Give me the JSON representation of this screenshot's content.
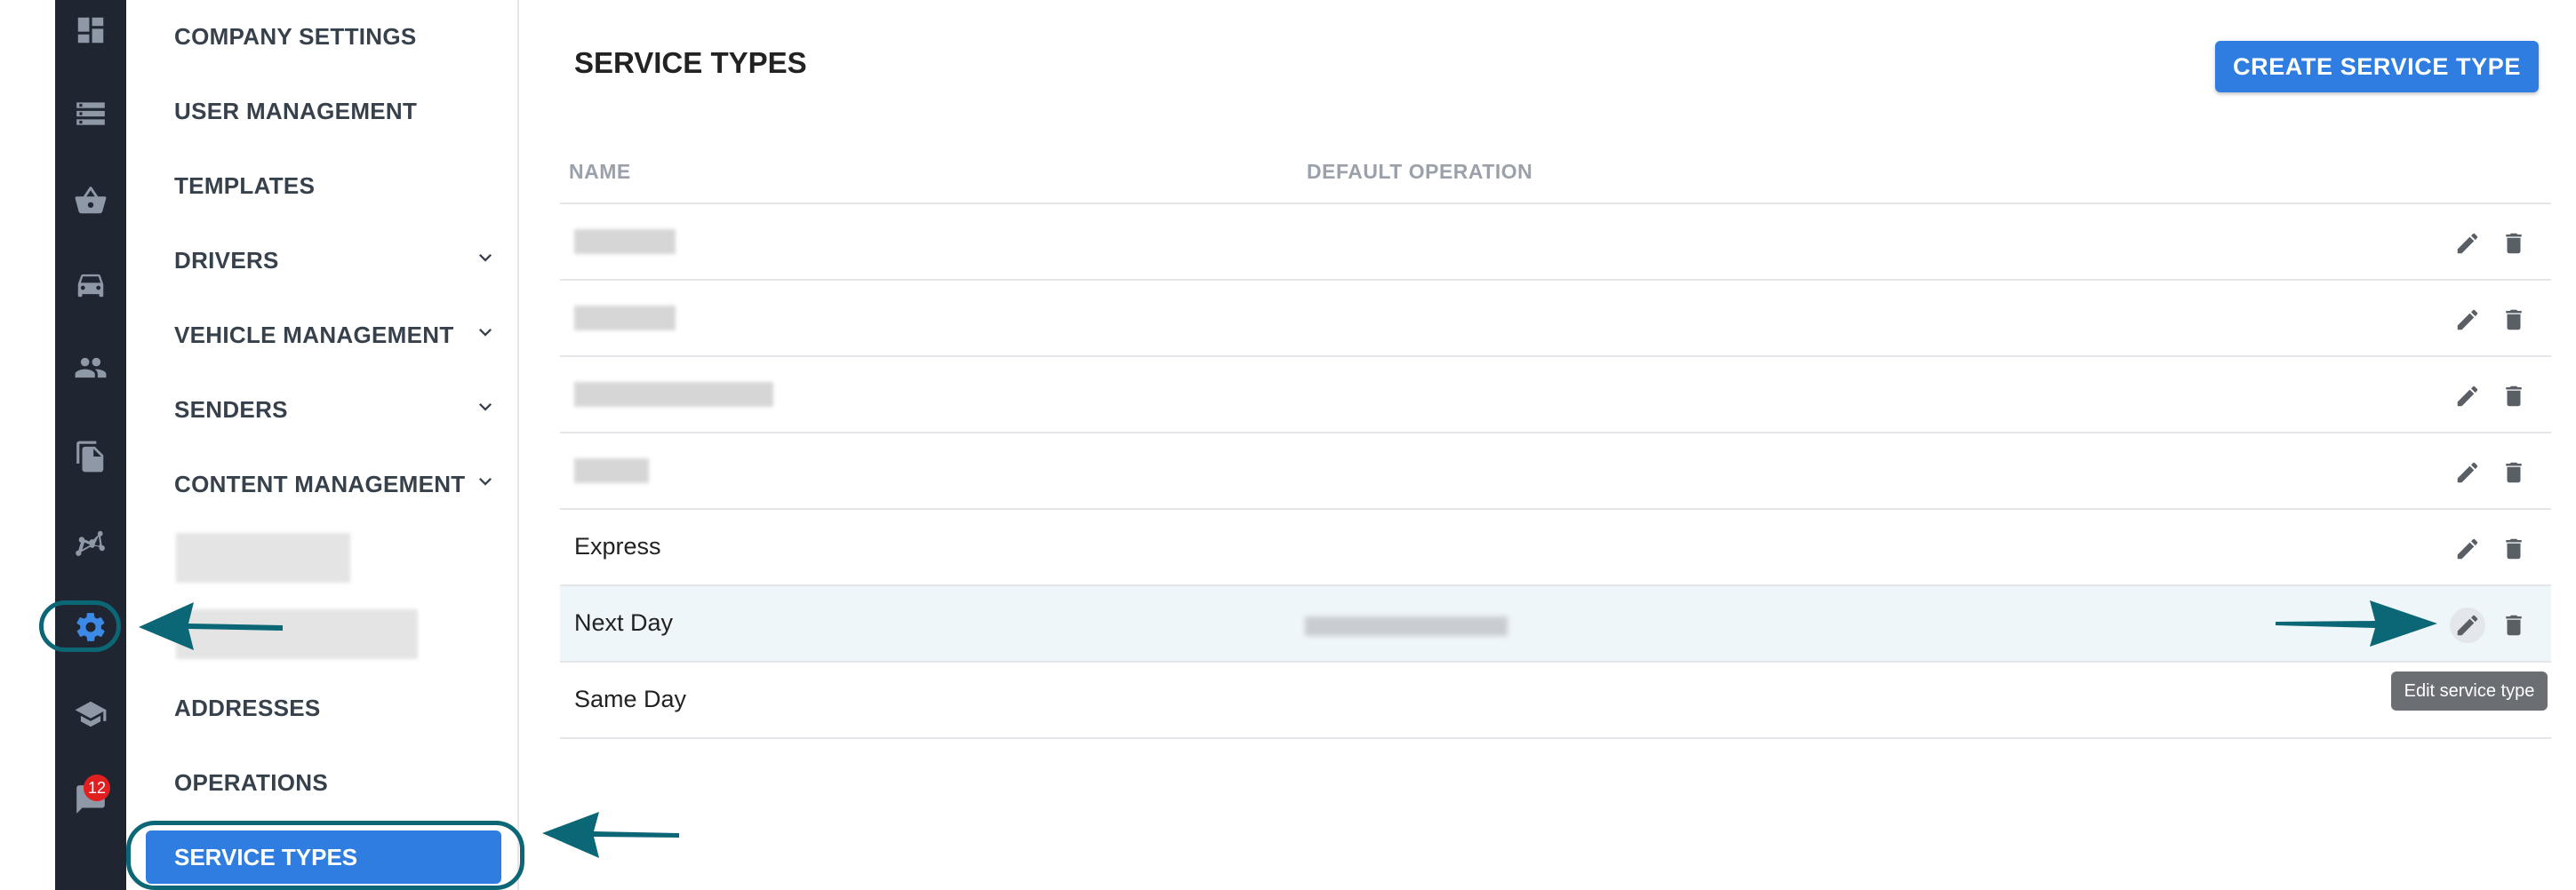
{
  "rail": {
    "icons": [
      "dashboard-icon",
      "storage-icon",
      "basket-icon",
      "car-icon",
      "people-icon",
      "documents-icon",
      "map-route-icon",
      "gear-icon",
      "school-icon",
      "chat-icon"
    ],
    "active": "gear-icon",
    "chat_badge": "12"
  },
  "menu": {
    "items": [
      {
        "label": "COMPANY SETTINGS"
      },
      {
        "label": "USER MANAGEMENT"
      },
      {
        "label": "TEMPLATES"
      },
      {
        "label": "DRIVERS"
      },
      {
        "label": "VEHICLE MANAGEMENT"
      },
      {
        "label": "SENDERS"
      },
      {
        "label": "CONTENT MANAGEMENT"
      },
      {
        "label": "ADDRESSES"
      },
      {
        "label": "OPERATIONS"
      }
    ],
    "active_label": "SERVICE TYPES"
  },
  "main": {
    "title": "SERVICE TYPES",
    "create_button": "CREATE SERVICE TYPE",
    "columns": [
      "NAME",
      "DEFAULT OPERATION"
    ],
    "rows": [
      {
        "name": ""
      },
      {
        "name": ""
      },
      {
        "name": ""
      },
      {
        "name": ""
      },
      {
        "name": "Express"
      },
      {
        "name": "Next Day"
      },
      {
        "name": "Same Day"
      }
    ],
    "tooltip": "Edit service type"
  },
  "colors": {
    "accent": "#2f7de1",
    "rail_bg": "#1f2631",
    "annotation": "#0b6675",
    "highlight_row": "#eef6f9"
  }
}
